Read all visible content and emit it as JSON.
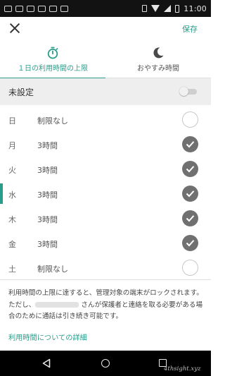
{
  "status_bar": {
    "time": "11:00",
    "notification_icons": [
      "app-icon",
      "app-icon",
      "app-icon",
      "photo-icon",
      "app-icon",
      "app-icon"
    ],
    "system_icons": [
      "vibrate-icon",
      "wifi-icon",
      "signal-icon",
      "battery-icon"
    ]
  },
  "header": {
    "close_icon": "close-icon",
    "save_label": "保存"
  },
  "tabs": [
    {
      "label": "１日の利用時間の上限",
      "icon": "stopwatch-icon",
      "active": true
    },
    {
      "label": "おやすみ時間",
      "icon": "moon-icon",
      "active": false
    }
  ],
  "unset": {
    "label": "未設定",
    "toggle_on": false
  },
  "days": [
    {
      "day": "日",
      "limit": "制限なし",
      "checked": false
    },
    {
      "day": "月",
      "limit": "3時間",
      "checked": true
    },
    {
      "day": "火",
      "limit": "3時間",
      "checked": true
    },
    {
      "day": "水",
      "limit": "3時間",
      "checked": true
    },
    {
      "day": "木",
      "limit": "3時間",
      "checked": true
    },
    {
      "day": "金",
      "limit": "3時間",
      "checked": true
    },
    {
      "day": "土",
      "limit": "制限なし",
      "checked": false
    }
  ],
  "selected_day_index": 3,
  "info": {
    "line1": "利用時間の上限に達すると、管理対象の端末がロックされます。ただし、",
    "line2": " さんが保護者と連絡を取る必要がある場合のために通話は引き続き可能です。"
  },
  "detail_link": "利用時間についての詳細",
  "nav_bar": [
    "back-icon",
    "home-icon",
    "recents-icon"
  ],
  "watermark": "4thsight.xyz",
  "colors": {
    "accent": "#2a9d8a",
    "check_fill": "#707070",
    "unset_row_bg": "#eeeeee",
    "status_bar_bg": "#121212"
  }
}
